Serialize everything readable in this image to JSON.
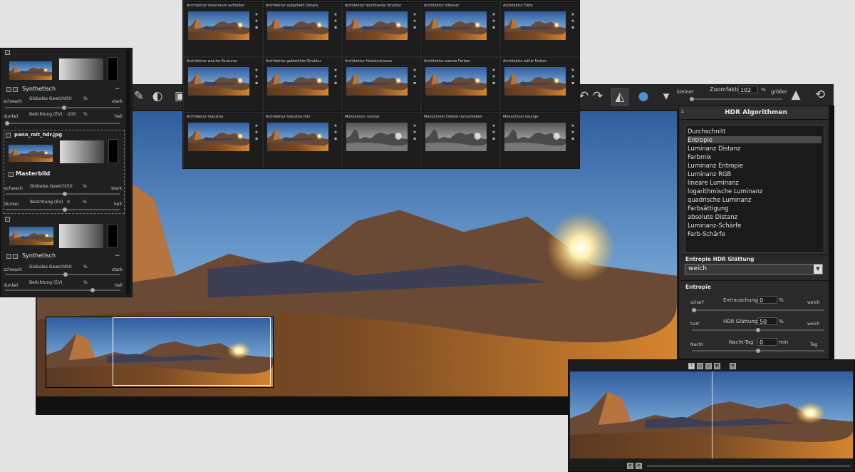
{
  "toolbar": {
    "zoom_min_label": "kleiner",
    "zoom_label": "Zoomfaktor",
    "zoom_value": "102",
    "zoom_unit": "%",
    "zoom_max_label": "größer"
  },
  "presets": [
    {
      "label": "Architektur Innenraum aufhellen"
    },
    {
      "label": "Architektur aufgehellt Details"
    },
    {
      "label": "Architektur leuchtende Struktur"
    },
    {
      "label": "Architektur intensiv"
    },
    {
      "label": "Architektur Tiefe"
    },
    {
      "label": "Architektur weiche Konturen"
    },
    {
      "label": "Architektur gebleichte Struktur"
    },
    {
      "label": "Architektur Holzstrukturen"
    },
    {
      "label": "Architektur warme Farben"
    },
    {
      "label": "Architektur kühle Farben"
    },
    {
      "label": "Architektur Industrie"
    },
    {
      "label": "Architektur Industrie fein"
    },
    {
      "label": "Monochrom normal"
    },
    {
      "label": "Monochrom Details hervorheben"
    },
    {
      "label": "Monochrom Grunge"
    }
  ],
  "layers": {
    "layer1": {
      "mode": "Synthetisch",
      "weight_label": "Globales Gewicht",
      "weight_value": "50",
      "weight_unit": "%",
      "min_label": "schwach",
      "max_label": "stark",
      "exposure_label": "Belichtung (EV)",
      "exposure_value": "-100",
      "exposure_unit": "%",
      "dark_label": "dunkel",
      "bright_label": "hell"
    },
    "layer2": {
      "filename": "pano_mit_hdr.jpg",
      "mode": "Masterbild",
      "weight_label": "Globales Gewicht",
      "weight_value": "50",
      "weight_unit": "%",
      "min_label": "schwach",
      "max_label": "stark",
      "exposure_label": "Belichtung (EV)",
      "exposure_value": "0",
      "exposure_unit": "%",
      "dark_label": "dunkel",
      "bright_label": "hell"
    },
    "layer3": {
      "mode": "Synthetisch",
      "weight_label": "Globales Gewicht",
      "weight_value": "50",
      "weight_unit": "%",
      "min_label": "schwach",
      "max_label": "stark",
      "exposure_label": "Belichtung (EV)",
      "exposure_value": "",
      "exposure_unit": "%",
      "dark_label": "dunkel",
      "bright_label": "hell"
    }
  },
  "hdr_panel": {
    "title": "HDR Algorithmen",
    "algorithms": [
      "Durchschnitt",
      "Entropie",
      "Luminanz Distanz",
      "Farbmix",
      "Luminanz Entropie",
      "Luminanz RGB",
      "lineare Luminanz",
      "logarithmische Luminanz",
      "quadrische Luminanz",
      "Farbsättigung",
      "absolute Distanz",
      "Luminanz-Schärfe",
      "Farb-Schärfe"
    ],
    "selected_index": 1,
    "smoothing_title": "Entropie HDR Glättung",
    "smoothing_value": "weich",
    "entropy_title": "Entropie",
    "noise_label": "Entrauschung",
    "noise_value": "0",
    "noise_unit": "%",
    "noise_min": "scharf",
    "noise_max": "weich",
    "smooth_label": "HDR Glättung",
    "smooth_value": "50",
    "smooth_unit": "%",
    "smooth_min": "hart",
    "smooth_max": "weich",
    "daynight_label": "Nacht-Tag",
    "daynight_value": "0",
    "daynight_unit": "min",
    "daynight_min": "Nacht",
    "daynight_max": "Tag"
  },
  "preview": {
    "split_fraction": 0.5
  },
  "colors": {
    "panel_bg": "#232323",
    "selection": "#4a4a4a",
    "sky_top": "#3f6fae",
    "sun": "#fff2b0",
    "mountain_lit": "#b7743f"
  }
}
